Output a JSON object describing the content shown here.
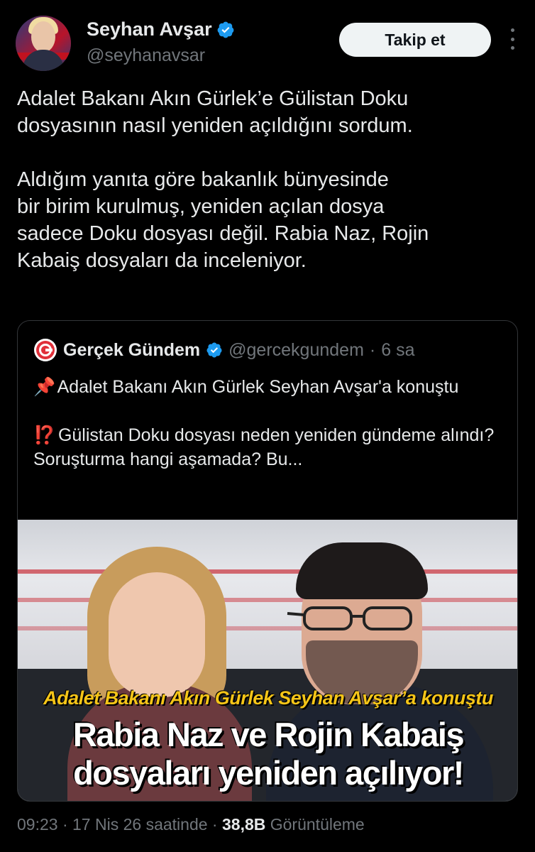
{
  "author": {
    "name": "Seyhan Avşar",
    "handle": "@seyhanavsar",
    "verified": true,
    "avatar_icon": "avatar-photo"
  },
  "follow_button": {
    "label": "Takip et"
  },
  "more_icon": "more-vertical-icon",
  "tweet": {
    "paragraph1": "Adalet Bakanı Akın Gürlek’e Gülistan Doku\ndosyasının nasıl yeniden açıldığını sordum.",
    "paragraph2": "Aldığım yanıta göre bakanlık bünyesinde\nbir birim kurulmuş, yeniden açılan dosya\nsadece Doku dosyası değil. Rabia Naz, Rojin\nKabaiş dosyaları da inceleniyor."
  },
  "quoted": {
    "name": "Gerçek Gündem",
    "handle": "@gercekgundem",
    "separator": "·",
    "time": "6 sa",
    "line1_emoji": "📌",
    "line1": "Adalet Bakanı Akın Gürlek Seyhan Avşar'a konuştu",
    "line2_emoji": "⁉️",
    "line2": "Gülistan Doku dosyası neden yeniden gündeme alındı? Soruşturma hangi aşamada? Bu...",
    "image": {
      "caption_top": "Adalet Bakanı Akın Gürlek Seyhan Avşar’a konuştu",
      "headline_line1": "Rabia Naz ve Rojin Kabaiş",
      "headline_line2": "dosyaları yeniden açılıyor!"
    }
  },
  "meta": {
    "time": "09:23",
    "sep1": "·",
    "date": "17 Nis 26 saatinde",
    "sep2": "·",
    "views": "38,8B",
    "views_label": "Görüntüleme"
  },
  "colors": {
    "background": "#000000",
    "text": "#e7e9ea",
    "muted": "#71767b",
    "verified": "#1d9bf0",
    "banner_yellow": "#f5c518"
  }
}
